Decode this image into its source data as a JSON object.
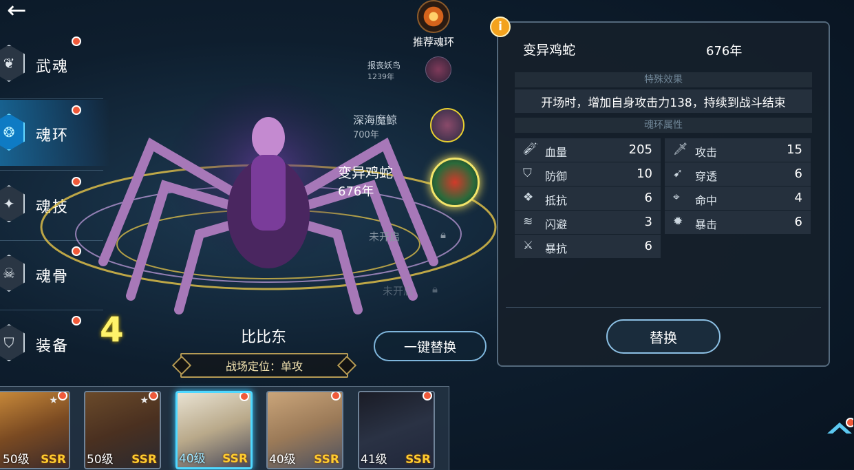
{
  "nav": {
    "back_icon": "back-arrow-icon"
  },
  "menu": [
    {
      "label": "武魂",
      "icon": "martial-soul-icon",
      "badge": true,
      "active": false
    },
    {
      "label": "魂环",
      "icon": "soul-ring-icon",
      "badge": true,
      "active": true
    },
    {
      "label": "魂技",
      "icon": "soul-skill-icon",
      "badge": true,
      "active": false
    },
    {
      "label": "魂骨",
      "icon": "soul-bone-icon",
      "badge": true,
      "active": false
    },
    {
      "label": "装备",
      "icon": "equipment-icon",
      "badge": true,
      "active": false
    }
  ],
  "recommend": {
    "label": "推荐魂环"
  },
  "rings": [
    {
      "name": "报丧妖鸟",
      "year": "1239年"
    },
    {
      "name": "深海魔鲸",
      "year": "700年"
    },
    {
      "name": "变异鸡蛇",
      "year": "676年"
    }
  ],
  "locked": [
    {
      "label": "未开启"
    },
    {
      "label": "未开启"
    }
  ],
  "hero": {
    "ring_level": "4",
    "name": "比比东",
    "role": "战场定位：单攻",
    "one_key_replace": "一键替换"
  },
  "panel": {
    "info_icon": "i",
    "ring_name": "变异鸡蛇",
    "ring_year": "676年",
    "effect_title": "特殊效果",
    "effect_text": "开场时，增加自身攻击力138，持续到战斗结束",
    "attr_title": "魂环属性",
    "stats": [
      {
        "name": "血量",
        "value": "205",
        "icon": "hp-icon"
      },
      {
        "name": "攻击",
        "value": "15",
        "icon": "attack-icon"
      },
      {
        "name": "防御",
        "value": "10",
        "icon": "defense-icon"
      },
      {
        "name": "穿透",
        "value": "6",
        "icon": "penetration-icon"
      },
      {
        "name": "抵抗",
        "value": "6",
        "icon": "resist-icon"
      },
      {
        "name": "命中",
        "value": "4",
        "icon": "hit-icon"
      },
      {
        "name": "闪避",
        "value": "3",
        "icon": "dodge-icon"
      },
      {
        "name": "暴击",
        "value": "6",
        "icon": "crit-icon"
      },
      {
        "name": "暴抗",
        "value": "6",
        "icon": "crit-resist-icon"
      }
    ],
    "replace_label": "替换"
  },
  "heroes": [
    {
      "level": "50级",
      "rarity": "SSR",
      "selected": false,
      "stars": true
    },
    {
      "level": "50级",
      "rarity": "SSR",
      "selected": false,
      "stars": true
    },
    {
      "level": "40级",
      "rarity": "SSR",
      "selected": true,
      "stars": false
    },
    {
      "level": "40级",
      "rarity": "SSR",
      "selected": false,
      "stars": false
    },
    {
      "level": "41级",
      "rarity": "SSR",
      "selected": false,
      "stars": false
    }
  ],
  "colors": {
    "accent": "#3ad0ff",
    "badge": "#f05a3a",
    "rarity": "#ffcc2e",
    "level_number": "#fff36a"
  }
}
